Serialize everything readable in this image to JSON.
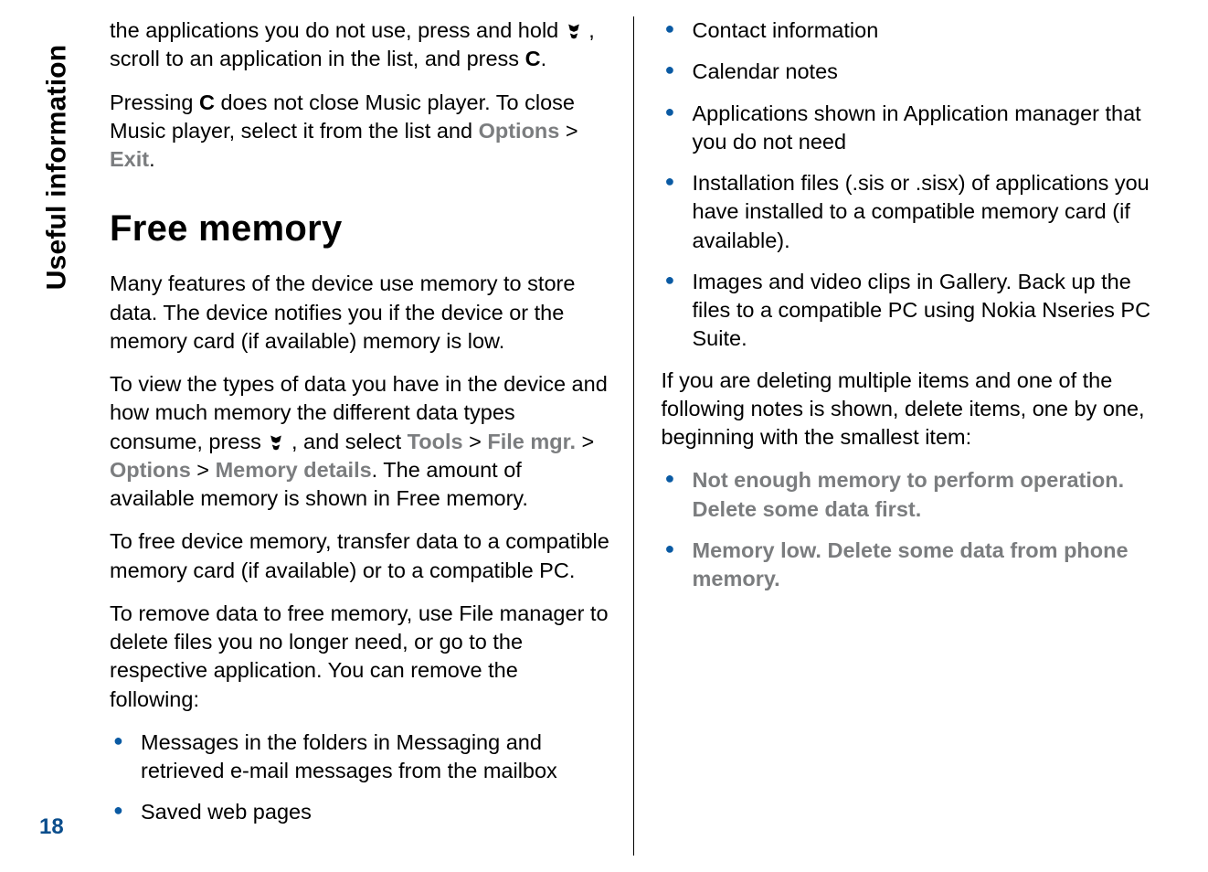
{
  "sideTab": "Useful information",
  "pageNumber": "18",
  "left": {
    "introPara_a": "the applications you do not use, press and hold ",
    "introPara_b": " , scroll to an application in the list, and press ",
    "introPara_c": "C",
    "introPara_d": ".",
    "para2_a": "Pressing ",
    "para2_b": "C",
    "para2_c": " does not close Music player. To close Music player, select it from the list and ",
    "para2_opt": "Options",
    "para2_gt": " > ",
    "para2_exit": "Exit",
    "para2_end": ".",
    "heading": "Free memory",
    "para3": "Many features of the device use memory to store data. The device notifies you if the device or the memory card (if available) memory is low.",
    "para4_a": "To view the types of data you have in the device and how much memory the different data types consume, press ",
    "para4_b": " , and select ",
    "para4_tools": "Tools",
    "para4_gt1": " > ",
    "para4_fm": "File mgr.",
    "para4_gt2": " > ",
    "para4_opt": "Options",
    "para4_gt3": " > ",
    "para4_md": "Memory details",
    "para4_c": ". The amount of available memory is shown in Free memory.",
    "para5": "To free device memory, transfer data to a compatible memory card (if available) or to a compatible PC.",
    "para6": "To remove data to free memory, use File manager to delete files you no longer need, or go to the respective application. You can remove the following:",
    "bullets": [
      "Messages in the folders in Messaging and retrieved e-mail messages from the mailbox",
      "Saved web pages"
    ]
  },
  "right": {
    "bullets": [
      "Contact information",
      "Calendar notes",
      "Applications shown in Application manager that you do not need",
      "Installation files (.sis or .sisx) of applications you have installed to a compatible memory card (if available).",
      "Images and video clips in Gallery. Back up the files to a compatible PC using Nokia Nseries PC Suite."
    ],
    "para1": "If you are deleting multiple items and one of the following notes is shown, delete items, one by one, beginning with the smallest item:",
    "warnings": [
      "Not enough memory to perform operation. Delete some data first.",
      "Memory low. Delete some data from phone memory."
    ]
  }
}
